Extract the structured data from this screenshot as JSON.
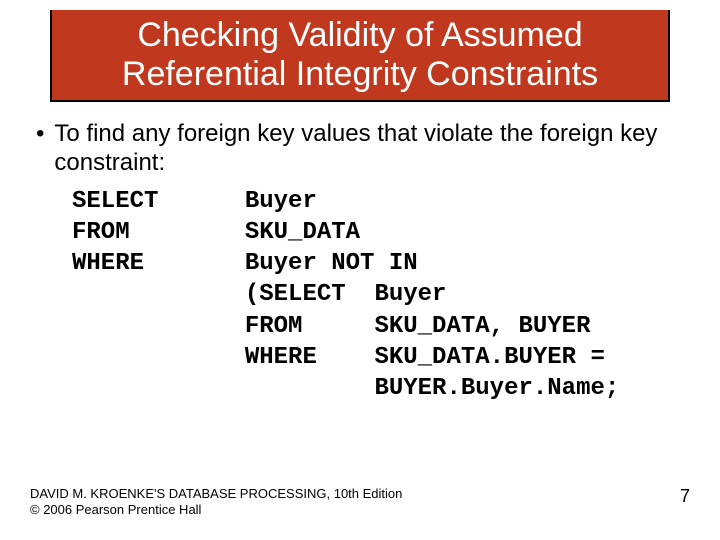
{
  "title": "Checking Validity of Assumed Referential Integrity Constraints",
  "bullet": "To find any foreign key values that violate the foreign key constraint:",
  "sql": "SELECT      Buyer\nFROM        SKU_DATA\nWHERE       Buyer NOT IN\n            (SELECT  Buyer\n            FROM     SKU_DATA, BUYER\n            WHERE    SKU_DATA.BUYER =\n                     BUYER.Buyer.Name;",
  "footer_line1": "DAVID M. KROENKE'S DATABASE PROCESSING, 10th Edition",
  "footer_line2": "© 2006 Pearson Prentice Hall",
  "page_number": "7"
}
